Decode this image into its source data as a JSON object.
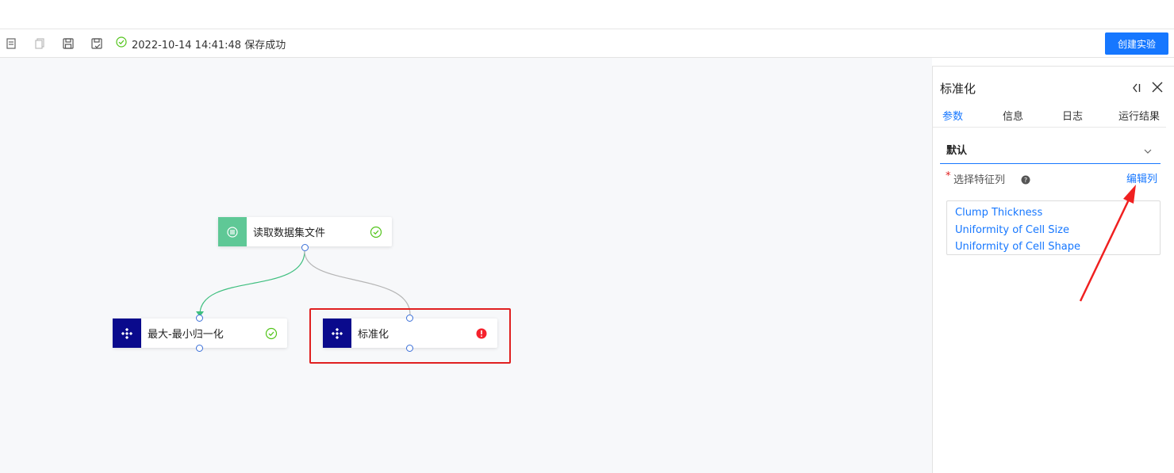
{
  "toolbar": {
    "icons": [
      "copy-icon",
      "duplicate-icon",
      "save-icon",
      "save-as-icon"
    ],
    "status_icon": "check-circle-icon",
    "status_text": "2022-10-14 14:41:48 保存成功",
    "create_button": "创建实验"
  },
  "canvas": {
    "nodes": [
      {
        "label": "读取数据集文件",
        "icon": "dataset-icon",
        "icon_color": "#5fc896",
        "status": "success"
      },
      {
        "label": "最大-最小归一化",
        "icon": "component-icon",
        "icon_color": "#0a0a8c",
        "status": "success"
      },
      {
        "label": "标准化",
        "icon": "component-icon",
        "icon_color": "#0a0a8c",
        "status": "error"
      }
    ],
    "edge_colors": {
      "done": "#3fbf7f",
      "pending": "#b5b5b5"
    },
    "highlight_color": "#e02020"
  },
  "panel": {
    "title": "标准化",
    "tabs": [
      "参数",
      "信息",
      "日志",
      "运行结果"
    ],
    "active_tab": "参数",
    "section": "默认",
    "field_required_mark": "*",
    "field_label": "选择特征列",
    "edit_link": "编辑列",
    "columns": [
      "Clump Thickness",
      "Uniformity of Cell Size",
      "Uniformity of Cell Shape"
    ]
  },
  "colors": {
    "accent": "#1677ff",
    "success": "#52c41a",
    "error": "#f5222d",
    "annotation": "#e02020"
  }
}
